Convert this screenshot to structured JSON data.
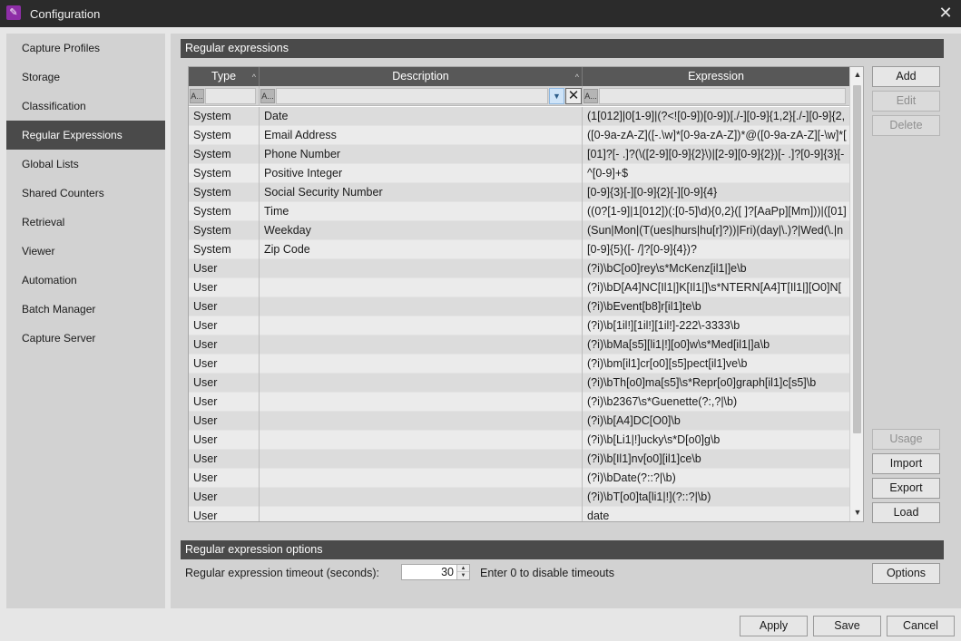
{
  "window": {
    "title": "Configuration",
    "app_icon": "app-logo-icon",
    "close_glyph": "✕"
  },
  "sidebar": {
    "items": [
      {
        "label": "Capture Profiles"
      },
      {
        "label": "Storage"
      },
      {
        "label": "Classification"
      },
      {
        "label": "Regular Expressions",
        "active": true
      },
      {
        "label": "Global Lists"
      },
      {
        "label": "Shared Counters"
      },
      {
        "label": "Retrieval"
      },
      {
        "label": "Viewer"
      },
      {
        "label": "Automation"
      },
      {
        "label": "Batch Manager"
      },
      {
        "label": "Capture Server"
      }
    ]
  },
  "regex": {
    "title": "Regular expressions",
    "columns": {
      "type": "Type",
      "description": "Description",
      "expression": "Expression"
    },
    "rows": [
      {
        "type": "System",
        "description": "Date",
        "expression": "(1[012]|0[1-9]|(?<![0-9])[0-9])[./-][0-9]{1,2}[./-][0-9]{2,"
      },
      {
        "type": "System",
        "description": "Email Address",
        "expression": "([0-9a-zA-Z]([-.\\w]*[0-9a-zA-Z])*@([0-9a-zA-Z][-\\w]*["
      },
      {
        "type": "System",
        "description": "Phone Number",
        "expression": "[01]?[- .]?(\\([2-9][0-9]{2}\\)|[2-9][0-9]{2})[- .]?[0-9]{3}[-"
      },
      {
        "type": "System",
        "description": "Positive Integer",
        "expression": "^[0-9]+$"
      },
      {
        "type": "System",
        "description": "Social Security Number",
        "expression": "[0-9]{3}[-][0-9]{2}[-][0-9]{4}"
      },
      {
        "type": "System",
        "description": "Time",
        "expression": "((0?[1-9]|1[012])(:[0-5]\\d){0,2}([ ]?[AaPp][Mm]))|([01]"
      },
      {
        "type": "System",
        "description": "Weekday",
        "expression": "(Sun|Mon|(T(ues|hurs|hu[r]?))|Fri)(day|\\.)?|Wed(\\.|n"
      },
      {
        "type": "System",
        "description": "Zip Code",
        "expression": "[0-9]{5}([- /]?[0-9]{4})?"
      },
      {
        "type": "User",
        "description": "",
        "expression": "(?i)\\bC[o0]rey\\s*McKenz[il1|]e\\b"
      },
      {
        "type": "User",
        "description": "",
        "expression": "(?i)\\bD[A4]NC[Il1|]K[Il1|]\\s*NTERN[A4]T[Il1|][O0]N["
      },
      {
        "type": "User",
        "description": "",
        "expression": "(?i)\\bEvent[b8]r[il1]te\\b"
      },
      {
        "type": "User",
        "description": "",
        "expression": "(?i)\\b[1il!][1il!][1il!]-222\\-3333\\b"
      },
      {
        "type": "User",
        "description": "",
        "expression": "(?i)\\bMa[s5][li1|!][o0]w\\s*Med[il1|]a\\b"
      },
      {
        "type": "User",
        "description": "",
        "expression": "(?i)\\bm[il1]cr[o0][s5]pect[il1]ve\\b"
      },
      {
        "type": "User",
        "description": "",
        "expression": "(?i)\\bTh[o0]ma[s5]\\s*Repr[o0]graph[il1]c[s5]\\b"
      },
      {
        "type": "User",
        "description": "",
        "expression": "(?i)\\b2367\\s*Guenette(?:,?|\\b)"
      },
      {
        "type": "User",
        "description": "",
        "expression": "(?i)\\b[A4]DC[O0]\\b"
      },
      {
        "type": "User",
        "description": "",
        "expression": "(?i)\\b[Li1|!]ucky\\s*D[o0]g\\b"
      },
      {
        "type": "User",
        "description": "",
        "expression": "(?i)\\b[Il1]nv[o0][il1]ce\\b"
      },
      {
        "type": "User",
        "description": "",
        "expression": "(?i)\\bDate(?::?|\\b)"
      },
      {
        "type": "User",
        "description": "",
        "expression": "(?i)\\bT[o0]ta[li1|!](?::?|\\b)"
      },
      {
        "type": "User",
        "description": "",
        "expression": "date"
      }
    ],
    "filter_glyph": "A...",
    "buttons": {
      "add": "Add",
      "edit": "Edit",
      "delete": "Delete",
      "usage": "Usage",
      "import": "Import",
      "export": "Export",
      "load": "Load"
    }
  },
  "options": {
    "title": "Regular expression options",
    "timeout_label": "Regular expression timeout (seconds):",
    "timeout_value": "30",
    "hint": "Enter 0 to disable timeouts",
    "options_button": "Options"
  },
  "footer": {
    "apply": "Apply",
    "save": "Save",
    "cancel": "Cancel"
  }
}
